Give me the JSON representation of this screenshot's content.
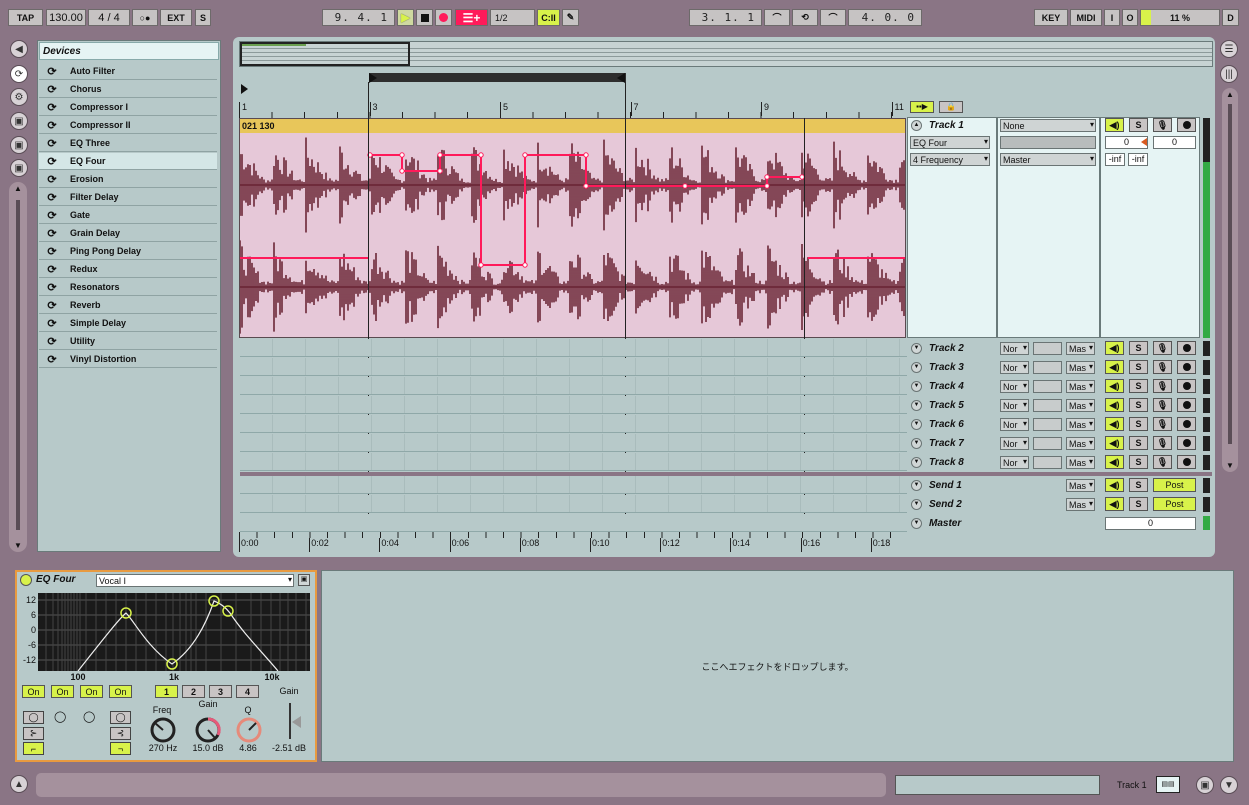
{
  "transport": {
    "tap": "TAP",
    "tempo": "130.00",
    "signature": "4 / 4",
    "metro": "○●",
    "ext": "EXT",
    "s": "S",
    "position": "9.  4.  1",
    "quantize": "1/2",
    "loop_start": "3.  1.  1",
    "loop_length": "4.  0.  0",
    "key": "KEY",
    "midi": "MIDI",
    "in": "I",
    "out": "O",
    "cpu": "11 %",
    "d": "D"
  },
  "browser": {
    "header": "Devices",
    "items": [
      "Auto Filter",
      "Chorus",
      "Compressor I",
      "Compressor II",
      "EQ Three",
      "EQ Four",
      "Erosion",
      "Filter Delay",
      "Gate",
      "Grain Delay",
      "Ping Pong Delay",
      "Redux",
      "Resonators",
      "Reverb",
      "Simple Delay",
      "Utility",
      "Vinyl Distortion"
    ],
    "selected": "EQ Four"
  },
  "ruler": {
    "bars": [
      "1",
      "3",
      "5",
      "7",
      "9",
      "11"
    ],
    "times": [
      "0:00",
      "0:02",
      "0:04",
      "0:06",
      "0:08",
      "0:10",
      "0:12",
      "0:14",
      "0:16",
      "0:18"
    ]
  },
  "clip": {
    "name": "021 130"
  },
  "track1": {
    "name": "Track 1",
    "input": "None",
    "device": "EQ Four",
    "param": "4 Frequency",
    "output": "Master",
    "vol": "0",
    "pan": "0",
    "peak_l": "-inf",
    "peak_r": "-inf"
  },
  "tracks": [
    {
      "name": "Track 2",
      "in": "Nor",
      "out": "Mas"
    },
    {
      "name": "Track 3",
      "in": "Nor",
      "out": "Mas"
    },
    {
      "name": "Track 4",
      "in": "Nor",
      "out": "Mas"
    },
    {
      "name": "Track 5",
      "in": "Nor",
      "out": "Mas"
    },
    {
      "name": "Track 6",
      "in": "Nor",
      "out": "Mas"
    },
    {
      "name": "Track 7",
      "in": "Nor",
      "out": "Mas"
    },
    {
      "name": "Track 8",
      "in": "Nor",
      "out": "Mas"
    }
  ],
  "sends": [
    {
      "name": "Send 1",
      "out": "Mas",
      "post": "Post"
    },
    {
      "name": "Send 2",
      "out": "Mas",
      "post": "Post"
    }
  ],
  "master": {
    "name": "Master",
    "vol": "0"
  },
  "mixer_labels": {
    "s": "S"
  },
  "eq": {
    "title": "EQ Four",
    "preset": "Vocal I",
    "db_labels": [
      "12",
      "6",
      "0",
      "-6",
      "-12"
    ],
    "freq_labels": [
      "100",
      "1k",
      "10k"
    ],
    "on_labels": [
      "On",
      "On",
      "On",
      "On"
    ],
    "bands": [
      "1",
      "2",
      "3",
      "4"
    ],
    "freq_label": "Freq",
    "gain_label": "Gain",
    "q_label": "Q",
    "out_gain_label": "Gain",
    "freq_value": "270 Hz",
    "gain_value": "15.0 dB",
    "q_value": "4.86",
    "out_gain_value": "-2.51 dB"
  },
  "drop_hint": "ここへエフェクトをドロップします。",
  "status": {
    "track": "Track 1"
  },
  "colors": {
    "accent": "#d8f24a",
    "clip": "#e8c65a",
    "wave": "#5a1020",
    "wave_bg": "#e6c8d8",
    "envelope": "#ff1a5a",
    "panel": "#b7c9c9"
  }
}
